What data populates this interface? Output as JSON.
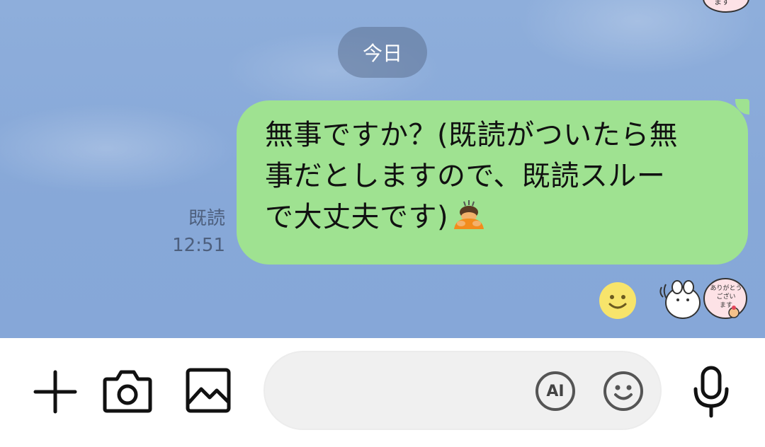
{
  "chat": {
    "date_label": "今日",
    "top_sticker_text": "ます",
    "message": {
      "lines": [
        "無事ですか？(既読がついたら無",
        "事だとしますので、既読スルー",
        "で大丈夫です)"
      ],
      "emoji": "bowing-person",
      "read_status": "既読",
      "time": "12:51"
    },
    "reactions": {
      "smiley": "smiley-reaction",
      "sticker_text": [
        "ありがとう",
        "ござい",
        "ます"
      ]
    }
  },
  "input_bar": {
    "plus_icon": "plus-icon",
    "camera_icon": "camera-icon",
    "image_icon": "image-icon",
    "message_placeholder": "",
    "ai_label": "AI",
    "emoji_icon": "smiley-icon",
    "mic_icon": "microphone-icon"
  },
  "colors": {
    "chat_background": "#8aabd9",
    "bubble_green": "#9fe291",
    "date_pill": "#5c7192",
    "input_bg": "#f0f0f0"
  }
}
